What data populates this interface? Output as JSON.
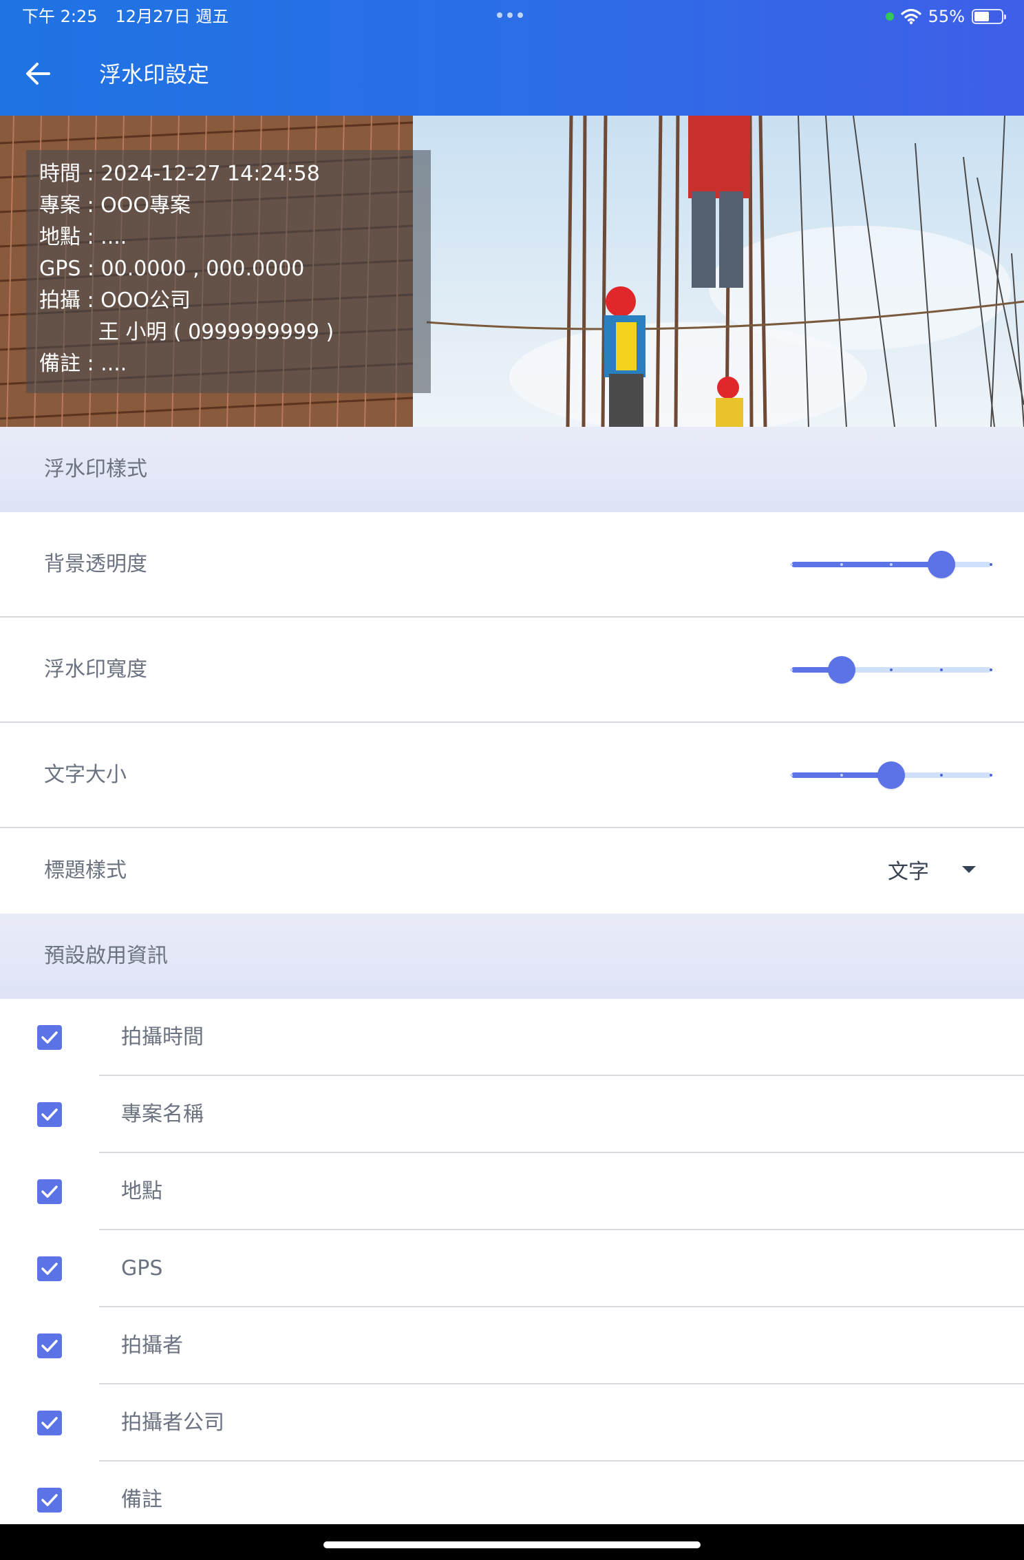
{
  "status_bar": {
    "time": "下午 2:25",
    "date": "12月27日 週五",
    "battery": "55%",
    "battery_level": 0.55
  },
  "header": {
    "title": "浮水印設定",
    "back_icon": "arrow-left-icon"
  },
  "preview": {
    "watermark_lines": [
      "時間 : 2024-12-27 14:24:58",
      "專案 : OOO專案",
      "地點 : ....",
      "GPS : 00.0000 , 000.0000",
      "拍攝 : OOO公司",
      "         王 小明 ( 0999999999 )",
      "備註 : ...."
    ]
  },
  "style_section": {
    "title": "浮水印樣式",
    "sliders": [
      {
        "label": "背景透明度",
        "value": 0.75,
        "steps": 4
      },
      {
        "label": "浮水印寬度",
        "value": 0.25,
        "steps": 4
      },
      {
        "label": "文字大小",
        "value": 0.5,
        "steps": 4
      }
    ],
    "title_style": {
      "label": "標題樣式",
      "value": "文字"
    }
  },
  "info_section": {
    "title": "預設啟用資訊",
    "items": [
      {
        "label": "拍攝時間",
        "checked": true
      },
      {
        "label": "專案名稱",
        "checked": true
      },
      {
        "label": "地點",
        "checked": true
      },
      {
        "label": "GPS",
        "checked": true
      },
      {
        "label": "拍攝者",
        "checked": true
      },
      {
        "label": "拍攝者公司",
        "checked": true
      },
      {
        "label": "備註",
        "checked": true
      }
    ]
  },
  "colors": {
    "header_start": "#1f73e3",
    "header_end": "#3f5fe9",
    "accent": "#5b73e6",
    "section_bg": "#e4e7f7"
  }
}
